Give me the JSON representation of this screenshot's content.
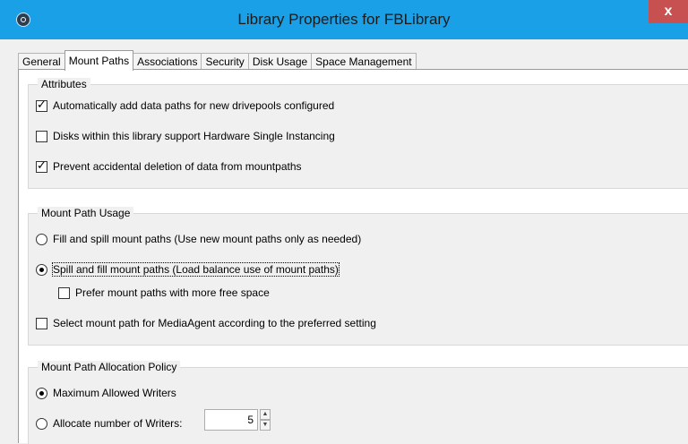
{
  "window": {
    "title": "Library Properties for FBLibrary",
    "close_label": "x"
  },
  "tabs": [
    {
      "label": "General",
      "active": false
    },
    {
      "label": "Mount Paths",
      "active": true
    },
    {
      "label": "Associations",
      "active": false
    },
    {
      "label": "Security",
      "active": false
    },
    {
      "label": "Disk Usage",
      "active": false
    },
    {
      "label": "Space Management",
      "active": false
    }
  ],
  "attributes": {
    "legend": "Attributes",
    "items": [
      {
        "label": "Automatically add data paths for new drivepools configured",
        "checked": true
      },
      {
        "label": "Disks within this library support Hardware Single Instancing",
        "checked": false
      },
      {
        "label": "Prevent accidental deletion of data from mountpaths",
        "checked": true
      }
    ]
  },
  "usage": {
    "legend": "Mount Path Usage",
    "fill_and_spill": "Fill and spill mount paths (Use new mount paths only as needed)",
    "spill_and_fill": "Spill and fill mount paths (Load balance use of mount paths)",
    "selected": "spill_and_fill",
    "prefer_free_space": {
      "label": "Prefer mount paths with more free space",
      "checked": false
    },
    "select_by_preferred": {
      "label": "Select mount path for MediaAgent according to the preferred setting",
      "checked": false
    }
  },
  "allocation": {
    "legend": "Mount Path Allocation Policy",
    "max_writers": "Maximum Allowed Writers",
    "allocate_writers": "Allocate number of Writers:",
    "selected": "max_writers",
    "writers_value": "5"
  }
}
